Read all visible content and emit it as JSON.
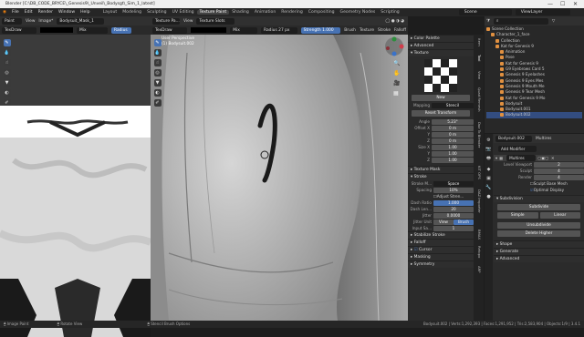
{
  "window": {
    "title": "Blender [C:\\DB_CODE_BRYCE\\_Genesis9\\_Unveil\\_Bodysgt\\_Sim_1_latest]",
    "controls": [
      "—",
      "☐",
      "✕"
    ]
  },
  "menubar": {
    "items": [
      "File",
      "Edit",
      "Render",
      "Window",
      "Help"
    ],
    "workspaces": [
      "Layout",
      "Modeling",
      "Sculpting",
      "UV Editing",
      "Texture Paint",
      "Shading",
      "Animation",
      "Rendering",
      "Compositing",
      "Geometry Nodes",
      "Scripting"
    ],
    "active_workspace": "Texture Paint",
    "scene": "Scene",
    "view_layer": "ViewLayer"
  },
  "image_editor": {
    "mode": "Paint",
    "menus": [
      "View",
      "Image*"
    ],
    "image_name": "Bodysuit_Mask_1",
    "brush": "TexDraw",
    "blend": "Mix",
    "radius_label": "Radius"
  },
  "viewport": {
    "mode": "Texture Pa...",
    "menus": [
      "View",
      "Texture Slots"
    ],
    "brush": "TexDraw",
    "blend": "Mix",
    "radius_label": "Radius",
    "radius_value": "27 px",
    "strength_label": "Strength",
    "strength_value": "1.000",
    "brush_menu": "Brush",
    "texture_menu": "Texture",
    "stroke_menu": "Stroke",
    "falloff_menu": "Falloff",
    "view_title": "User Perspective",
    "object_name": "(1) Bodysuit.002"
  },
  "side_panel": {
    "tabs": [
      "Item",
      "Tool",
      "View",
      "Quad Remesh",
      "Daz To Blender",
      "KIT OPS",
      "DAZ Importer",
      "BMAX",
      "Retopo",
      "ARP"
    ],
    "sections": {
      "color_palette": "Color Palette",
      "advanced": "Advanced",
      "texture": "Texture",
      "new_button": "New",
      "mapping_label": "Mapping",
      "mapping_value": "Stencil",
      "reset_transform": "Reset Transform",
      "angle_label": "Angle",
      "angle_value": "5.23°",
      "offset_x_label": "Offset X",
      "offset_x": "0 m",
      "offset_y_label": "Y",
      "offset_y": "0 m",
      "offset_z_label": "Z",
      "offset_z": "0 m",
      "size_x_label": "Size X",
      "size_x": "1.00",
      "size_y_label": "Y",
      "size_y": "1.00",
      "size_z_label": "Z",
      "size_z": "1.00",
      "texture_mask": "Texture Mask",
      "stroke": "Stroke",
      "stroke_method_label": "Stroke M...",
      "stroke_method_value": "Space",
      "spacing_label": "Spacing",
      "spacing_value": "10%",
      "adjust_strength": "Adjust Stren...",
      "dash_ratio_label": "Dash Ratio",
      "dash_ratio_value": "1.000",
      "dash_length_label": "Dash Len...",
      "dash_length_value": "20",
      "jitter_label": "Jitter",
      "jitter_value": "0.0000",
      "jitter_unit_label": "Jitter Unit",
      "jitter_unit_view": "View",
      "jitter_unit_brush": "Brush",
      "input_samples_label": "Input Sa...",
      "input_samples_value": "1",
      "stabilize_stroke": "Stabilize Stroke",
      "falloff": "Falloff",
      "cursor": "Cursor",
      "masking": "Masking",
      "symmetry": "Symmetry"
    }
  },
  "outliner": {
    "title": "Scene Collection",
    "items": [
      {
        "name": "Scene Collection",
        "indent": 0
      },
      {
        "name": "Character_1_face",
        "indent": 1
      },
      {
        "name": "Collection",
        "indent": 2
      },
      {
        "name": "Kat for Genesis 9",
        "indent": 2
      },
      {
        "name": "Animation",
        "indent": 3
      },
      {
        "name": "Pose",
        "indent": 3
      },
      {
        "name": "Kat for Genesis 9",
        "indent": 3
      },
      {
        "name": "G9 Eyebrows Card 5",
        "indent": 3
      },
      {
        "name": "Genesis 9 Eyelashes",
        "indent": 3
      },
      {
        "name": "Genesis 9 Eyes Mes",
        "indent": 3
      },
      {
        "name": "Genesis 9 Mouth Me",
        "indent": 3
      },
      {
        "name": "Genesis 9 Tear Mesh",
        "indent": 3
      },
      {
        "name": "Kat for Genesis 9 Mo",
        "indent": 3
      },
      {
        "name": "Bodysuit",
        "indent": 3
      },
      {
        "name": "Bodysuit.001",
        "indent": 3
      },
      {
        "name": "Bodysuit.002",
        "indent": 3
      }
    ]
  },
  "properties": {
    "object": "Bodysuit.002",
    "modifier_tab": "Multires",
    "add_modifier": "Add Modifier",
    "modifier_name": "Multires",
    "level_viewport_label": "Level Viewport",
    "level_viewport": "2",
    "sculpt_label": "Sculpt",
    "sculpt": "4",
    "render_label": "Render",
    "render": "4",
    "sculpt_base_mesh": "Sculpt Base Mesh",
    "optimal_display": "Optimal Display",
    "subdivision": "Subdivision",
    "subdivide": "Subdivide",
    "simple": "Simple",
    "linear": "Linear",
    "unsubdivide": "Unsubdivide",
    "delete_higher": "Delete Higher",
    "shape": "Shape",
    "generate": "Generate",
    "advanced": "Advanced"
  },
  "statusbar": {
    "left1": "Image Paint",
    "left2": "Rotate View",
    "middle": "Stencil Brush Options",
    "right": "Bodysuit.002 | Verts:1,292,393 | Faces:1,291,952 | Tris:2,583,904 | Objects:1/9 | 3.4.1"
  },
  "colors": {
    "accent": "#4772b3",
    "background": "#1d1d1d",
    "panel": "#2b2b2b",
    "viewport_model": "#b5b5b5"
  }
}
